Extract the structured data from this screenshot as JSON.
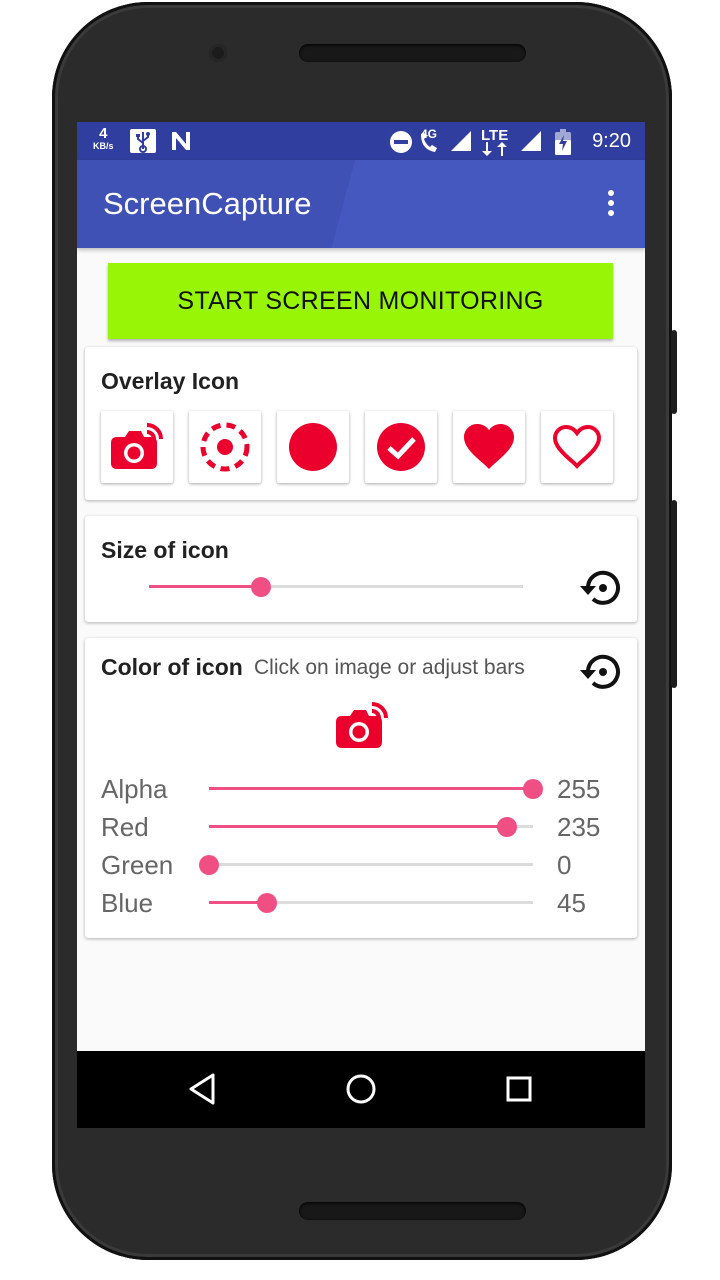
{
  "status_bar": {
    "speed_value": "4",
    "speed_unit": "KB/s",
    "network_label": "4G",
    "lte_label": "LTE",
    "time": "9:20"
  },
  "toolbar": {
    "title": "ScreenCapture",
    "menu_icon": "more-vert-icon"
  },
  "start_button": {
    "label": "START SCREEN MONITORING",
    "color": "#99f506"
  },
  "overlay_card": {
    "title": "Overlay Icon",
    "icons": [
      "camera-icon",
      "target-icon",
      "filled-circle-icon",
      "check-circle-icon",
      "filled-heart-icon",
      "outline-heart-icon"
    ]
  },
  "size_card": {
    "title": "Size of icon",
    "slider_value": 0.3,
    "reset_icon": "reset-icon"
  },
  "color_card": {
    "title": "Color of icon",
    "subtitle": "Click on image or adjust bars",
    "preview_icon": "camera-icon",
    "icon_color": "#eb002d",
    "channels": [
      {
        "label": "Alpha",
        "value": "255",
        "fraction": 1.0
      },
      {
        "label": "Red",
        "value": "235",
        "fraction": 0.92
      },
      {
        "label": "Green",
        "value": "0",
        "fraction": 0.0
      },
      {
        "label": "Blue",
        "value": "45",
        "fraction": 0.18
      }
    ]
  },
  "colors": {
    "primary": "#3f51b5",
    "primary_dark": "#303f9f",
    "accent": "#ef4f82",
    "icon_red": "#eb002d"
  },
  "nav_bar": {
    "icons": [
      "back-icon",
      "home-icon",
      "recents-icon"
    ]
  }
}
